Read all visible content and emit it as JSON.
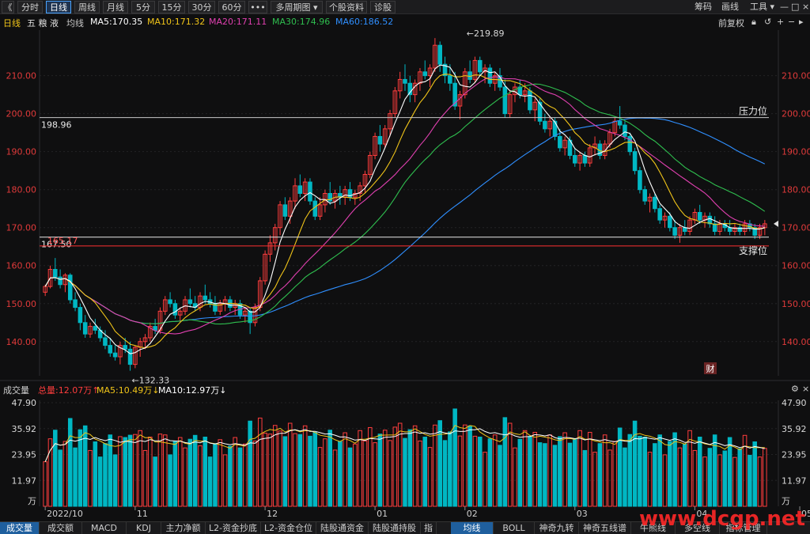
{
  "toolbar": {
    "left_tabs": [
      {
        "label": "《",
        "active": false
      },
      {
        "label": "分时",
        "active": false
      },
      {
        "label": "日线",
        "active": true
      },
      {
        "label": "周线",
        "active": false
      },
      {
        "label": "月线",
        "active": false
      },
      {
        "label": "5分",
        "active": false
      },
      {
        "label": "15分",
        "active": false
      },
      {
        "label": "30分",
        "active": false
      },
      {
        "label": "60分",
        "active": false
      },
      {
        "label": "•••",
        "active": false
      },
      {
        "label": "多周期图 ▾",
        "active": false
      },
      {
        "label": "个股资料",
        "active": false
      },
      {
        "label": "诊股",
        "active": false
      }
    ],
    "right_items": [
      "筹码",
      "画线",
      "工具 ▾"
    ]
  },
  "legend": {
    "period": "日线",
    "name": "五 粮 液",
    "ma_label": "均线",
    "ma5": "MA5:170.35",
    "ma10": "MA10:171.32",
    "ma20": "MA20:171.11",
    "ma30": "MA30:174.96",
    "ma60": "MA60:186.52",
    "right_label": "前复权"
  },
  "colors": {
    "up": "#ff3d3d",
    "down": "#00b7c3",
    "ma5": "#ffffff",
    "ma10": "#f0c419",
    "ma20": "#e040b0",
    "ma30": "#2fbf4f",
    "ma60": "#2f8fff",
    "axis_text": "#e03a3a",
    "bg": "#0f0f10"
  },
  "chart_data": [
    {
      "type": "candlestick",
      "title": "五粮液 日线",
      "y_ticks": [
        "210.00",
        "200.00",
        "190.00",
        "180.00",
        "170.00",
        "160.00",
        "150.00",
        "140.00"
      ],
      "ylim": [
        131,
        222
      ],
      "x_month_labels": [
        {
          "label": "2022/10",
          "index": 0
        },
        {
          "label": "11",
          "index": 18
        },
        {
          "label": "12",
          "index": 44
        },
        {
          "label": "01",
          "index": 66
        },
        {
          "label": "02",
          "index": 84
        },
        {
          "label": "03",
          "index": 106
        },
        {
          "label": "04",
          "index": 130
        },
        {
          "label": "05",
          "index": 151
        }
      ],
      "annotations": [
        {
          "text": "←219.89",
          "index": 84,
          "value": 219.89,
          "pos": "top"
        },
        {
          "text": "←132.33",
          "index": 17,
          "value": 132.33,
          "pos": "bottom"
        }
      ],
      "horizontal_lines": [
        {
          "value": 198.96,
          "left_label": "198.96",
          "right_label": "压力位",
          "color": "#c8c8c8"
        },
        {
          "value": 167.5,
          "left_label": "167.50",
          "right_label": "",
          "color": "#e8e8e8"
        },
        {
          "value": 165.17,
          "left_label": "165.17",
          "right_label": "支撑位",
          "color": "#ff3030"
        }
      ],
      "candles": [
        [
          153,
          155,
          152,
          154.5
        ],
        [
          154.5,
          160,
          154,
          159
        ],
        [
          159,
          162,
          156,
          157
        ],
        [
          157,
          159,
          154,
          155
        ],
        [
          155,
          158,
          153,
          157.5
        ],
        [
          157.5,
          158,
          150,
          151
        ],
        [
          151,
          153,
          148,
          149
        ],
        [
          149,
          150,
          143,
          145
        ],
        [
          145,
          147,
          141,
          142
        ],
        [
          142,
          145,
          141,
          144
        ],
        [
          144,
          146,
          142,
          143
        ],
        [
          143,
          144,
          140,
          141
        ],
        [
          141,
          143,
          138,
          139
        ],
        [
          139,
          141,
          136,
          137
        ],
        [
          137,
          139,
          135,
          136
        ],
        [
          136,
          140,
          134,
          139
        ],
        [
          139,
          141,
          137,
          138
        ],
        [
          138,
          140,
          132.33,
          134
        ],
        [
          134,
          139,
          133,
          138.5
        ],
        [
          138.5,
          141,
          136,
          140
        ],
        [
          140,
          142,
          138,
          141
        ],
        [
          141,
          145,
          140,
          144
        ],
        [
          144,
          146,
          142,
          143
        ],
        [
          143,
          149,
          142,
          148
        ],
        [
          148,
          152,
          147,
          151
        ],
        [
          151,
          153,
          149,
          150
        ],
        [
          150,
          151,
          146,
          147
        ],
        [
          147,
          149,
          145,
          148
        ],
        [
          148,
          152,
          147,
          151
        ],
        [
          151,
          154,
          149,
          150
        ],
        [
          150,
          152,
          148,
          149
        ],
        [
          149,
          153,
          148,
          152
        ],
        [
          152,
          155,
          150,
          151
        ],
        [
          151,
          153,
          149,
          150
        ],
        [
          150,
          152,
          147,
          148
        ],
        [
          148,
          151,
          147,
          150
        ],
        [
          150,
          152,
          148,
          151
        ],
        [
          151,
          152,
          148,
          149
        ],
        [
          149,
          151,
          147,
          150
        ],
        [
          150,
          151,
          146,
          147
        ],
        [
          147,
          149,
          145,
          148
        ],
        [
          148,
          149,
          142,
          145
        ],
        [
          145,
          150,
          144,
          149
        ],
        [
          149,
          157,
          148,
          156
        ],
        [
          156,
          164,
          155,
          163
        ],
        [
          163,
          168,
          161,
          166
        ],
        [
          166,
          171,
          164,
          170
        ],
        [
          170,
          177,
          168,
          176
        ],
        [
          176,
          178,
          172,
          173
        ],
        [
          173,
          178,
          171,
          177
        ],
        [
          177,
          183,
          175,
          181
        ],
        [
          181,
          184,
          178,
          179
        ],
        [
          179,
          183,
          177,
          182
        ],
        [
          182,
          183,
          176,
          177
        ],
        [
          177,
          178,
          172,
          173
        ],
        [
          173,
          178,
          172,
          176
        ],
        [
          176,
          180,
          174,
          179
        ],
        [
          179,
          182,
          176,
          177
        ],
        [
          177,
          180,
          175,
          179
        ],
        [
          179,
          181,
          176,
          178
        ],
        [
          178,
          181,
          176,
          180
        ],
        [
          180,
          182,
          177,
          178
        ],
        [
          178,
          180,
          176,
          179
        ],
        [
          179,
          182,
          177,
          181
        ],
        [
          181,
          185,
          179,
          184
        ],
        [
          184,
          190,
          183,
          189
        ],
        [
          189,
          195,
          188,
          194
        ],
        [
          194,
          197,
          190,
          192
        ],
        [
          192,
          197,
          191,
          196
        ],
        [
          196,
          201,
          194,
          200
        ],
        [
          200,
          207,
          199,
          206
        ],
        [
          206,
          211,
          204,
          209
        ],
        [
          209,
          213,
          206,
          208
        ],
        [
          208,
          210,
          203,
          205
        ],
        [
          205,
          209,
          203,
          208
        ],
        [
          208,
          212,
          206,
          211
        ],
        [
          211,
          214,
          209,
          210
        ],
        [
          210,
          213,
          207,
          212
        ],
        [
          212,
          219.89,
          211,
          218
        ],
        [
          218,
          219,
          211,
          213
        ],
        [
          213,
          215,
          208,
          210
        ],
        [
          210,
          213,
          206,
          208
        ],
        [
          208,
          211,
          201,
          202
        ],
        [
          202,
          206,
          198.5,
          205
        ],
        [
          205,
          212,
          204,
          211
        ],
        [
          211,
          214,
          208,
          209
        ],
        [
          209,
          215,
          208,
          214
        ],
        [
          214,
          215,
          210,
          211
        ],
        [
          211,
          213,
          208,
          212
        ],
        [
          212,
          213,
          207,
          208
        ],
        [
          208,
          211,
          206,
          210
        ],
        [
          210,
          212,
          206,
          207
        ],
        [
          207,
          209,
          199,
          200
        ],
        [
          200,
          206,
          199,
          205
        ],
        [
          205,
          208,
          203,
          207
        ],
        [
          207,
          209,
          204,
          205
        ],
        [
          205,
          208,
          203,
          206
        ],
        [
          206,
          207,
          200,
          201
        ],
        [
          201,
          204,
          198,
          203
        ],
        [
          203,
          204,
          197,
          198
        ],
        [
          198,
          200,
          195,
          196
        ],
        [
          196,
          199,
          194,
          198
        ],
        [
          198,
          199,
          193,
          194
        ],
        [
          194,
          196,
          190,
          191
        ],
        [
          191,
          194,
          189,
          193
        ],
        [
          193,
          194,
          188,
          189
        ],
        [
          189,
          191,
          186,
          187
        ],
        [
          187,
          190,
          185,
          189
        ],
        [
          189,
          190,
          186,
          187
        ],
        [
          187,
          192,
          186,
          191
        ],
        [
          191,
          194,
          189,
          192
        ],
        [
          192,
          193,
          188,
          189
        ],
        [
          189,
          193,
          188,
          192
        ],
        [
          192,
          196,
          191,
          195
        ],
        [
          195,
          199,
          194,
          198
        ],
        [
          198,
          202,
          196,
          197
        ],
        [
          197,
          198,
          193,
          194
        ],
        [
          194,
          195,
          189,
          190
        ],
        [
          190,
          191,
          184,
          185
        ],
        [
          185,
          186,
          179,
          180
        ],
        [
          180,
          181,
          176,
          177
        ],
        [
          177,
          179,
          174,
          178
        ],
        [
          178,
          179,
          174,
          175
        ],
        [
          175,
          176,
          171,
          172
        ],
        [
          172,
          174,
          170,
          173
        ],
        [
          173,
          174,
          169,
          170
        ],
        [
          170,
          172,
          167,
          168
        ],
        [
          168,
          171,
          166,
          170
        ],
        [
          170,
          172,
          168,
          169
        ],
        [
          169,
          173,
          168,
          172
        ],
        [
          172,
          175,
          171,
          174
        ],
        [
          174,
          176,
          171,
          172
        ],
        [
          172,
          174,
          170,
          173
        ],
        [
          173,
          174,
          170,
          171
        ],
        [
          171,
          173,
          168,
          169
        ],
        [
          169,
          172,
          168,
          171
        ],
        [
          171,
          172,
          169,
          170
        ],
        [
          170,
          172,
          168,
          169
        ],
        [
          169,
          171,
          168,
          170
        ],
        [
          170,
          171,
          168,
          169
        ],
        [
          169,
          172,
          168,
          171
        ],
        [
          171,
          172,
          169,
          170
        ],
        [
          170,
          171,
          167,
          168
        ],
        [
          168,
          171,
          167,
          170
        ],
        [
          170,
          172,
          168,
          171
        ]
      ]
    },
    {
      "type": "bar",
      "title": "成交量",
      "y_ticks": [
        "47.90",
        "35.92",
        "23.95",
        "11.97",
        "万"
      ],
      "ylim": [
        0,
        49
      ],
      "legend": {
        "label": "成交量",
        "total": "总量:12.07万↑",
        "ma5": "MA5:10.49万↓",
        "ma10": "MA10:12.97万↓"
      }
    }
  ],
  "bottom_tabs": {
    "left": [
      {
        "label": "成交量",
        "active": true
      },
      {
        "label": "成交额",
        "active": false
      },
      {
        "label": "MACD",
        "active": false
      },
      {
        "label": "KDJ",
        "active": false
      },
      {
        "label": "主力净额",
        "active": false
      },
      {
        "label": "L2-资金抄底",
        "active": false
      },
      {
        "label": "L2-资金仓位",
        "active": false
      },
      {
        "label": "陆股通资金",
        "active": false
      },
      {
        "label": "陆股通持股",
        "active": false
      },
      {
        "label": "指",
        "active": false
      }
    ],
    "right": [
      {
        "label": "均线",
        "active": true
      },
      {
        "label": "BOLL",
        "active": false
      },
      {
        "label": "神奇九转",
        "active": false
      },
      {
        "label": "神奇五线谱",
        "active": false
      },
      {
        "label": "牛熊线",
        "active": false
      },
      {
        "label": "多空线",
        "active": false
      },
      {
        "label": "指标管理",
        "active": false
      }
    ]
  },
  "badge": "财",
  "watermark": "www.dcgp.net"
}
